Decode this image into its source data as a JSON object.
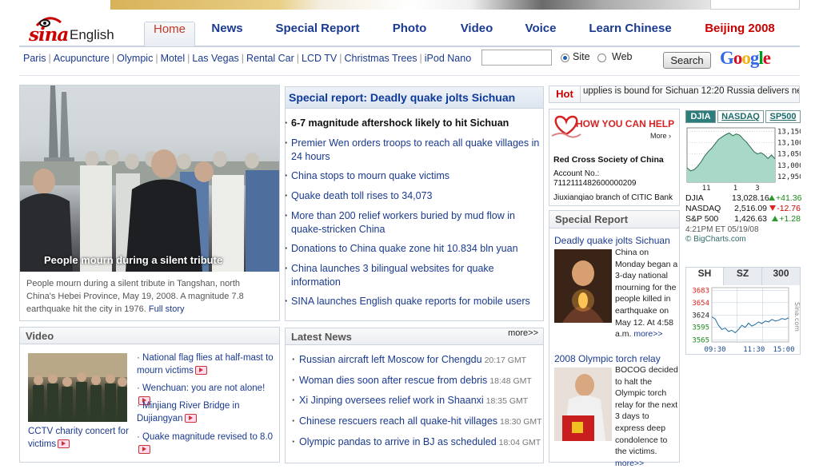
{
  "header": {
    "logo_text": "sina",
    "logo_suffix": "English",
    "nav": [
      "Home",
      "News",
      "Special Report",
      "Photo",
      "Video",
      "Voice",
      "Learn Chinese",
      "Beijing 2008"
    ],
    "quicklinks": [
      "Paris",
      "Acupuncture",
      "Olympic",
      "Motel",
      "Las Vegas",
      "Rental Car",
      "LCD TV",
      "Christmas Trees",
      "iPod Nano"
    ],
    "search": {
      "site_label": "Site",
      "web_label": "Web",
      "button": "Search",
      "value": ""
    },
    "google": [
      "G",
      "o",
      "o",
      "g",
      "l",
      "e"
    ]
  },
  "feature": {
    "caption": "People mourn during a silent tribute",
    "desc": "People mourn during a silent tribute in Tangshan, north China's Hebei Province, May 19, 2008. A magnitude 7.8 earthquake hit the city in 1976.",
    "link": "Full story"
  },
  "video": {
    "title": "Video",
    "thumb_caption": "CCTV charity concert for victims",
    "items": [
      "National flag flies at half-mast to mourn victims",
      "Wenchuan: you are not alone!",
      "Minjiang River Bridge in Dujiangyan",
      "Quake magnitude revised to 8.0"
    ]
  },
  "special_report": {
    "title": "Special report: Deadly quake jolts Sichuan",
    "items": [
      "6-7 magnitude aftershock likely to hit Sichuan",
      "Premier Wen orders troops to reach all quake villages in 24 hours",
      "China stops to mourn quake victims",
      "Quake death toll rises to 34,073",
      "More than 200 relief workers buried by mud flow in quake-stricken China",
      "Donations to China quake zone hit 10.834 bln yuan",
      "China launches 3 bilingual websites for quake information",
      "SINA launches English quake reports for mobile users"
    ]
  },
  "latest_news": {
    "title": "Latest News",
    "more": "more>>",
    "items": [
      {
        "title": "Russian aircraft left Moscow for Chengdu",
        "time": "20:17 GMT"
      },
      {
        "title": "Woman dies soon after rescue from debris",
        "time": "18:48 GMT"
      },
      {
        "title": "Xi Jinping oversees relief work in Shaanxi",
        "time": "18:35 GMT"
      },
      {
        "title": "Chinese rescuers reach all quake-hit villages",
        "time": "18:30 GMT"
      },
      {
        "title": "Olympic pandas to arrive in BJ as scheduled",
        "time": "18:04 GMT"
      }
    ]
  },
  "hot": {
    "label": "Hot",
    "ticker": "upplies is bound for Sichuan   12:20 Russia delivers new"
  },
  "help": {
    "title": "HOW YOU CAN HELP",
    "more": "More ›",
    "org": "Red Cross Society of China",
    "account": "Account No.: 7112111482600000209",
    "branch": "Jiuxianqiao branch of CITIC Bank"
  },
  "sidebar_special": {
    "title": "Special Report",
    "stories": [
      {
        "title": "Deadly quake jolts Sichuan",
        "text": "China on Monday began a 3-day national mourning for the people killed in earthquake on May 12. At 4:58 a.m.",
        "more": "more>>"
      },
      {
        "title": "2008 Olympic torch relay",
        "text": "BOCOG decided to halt the Olympic torch relay for the next 3 days to express deep condolence to the victims.",
        "more": "more>>"
      }
    ]
  },
  "markets": {
    "tabs": [
      "DJIA",
      "NASDAQ",
      "SP500"
    ],
    "rows": [
      {
        "name": "DJIA",
        "value": "13,028.16",
        "change": "+41.36",
        "dir": "up"
      },
      {
        "name": "NASDAQ",
        "value": "2,516.09",
        "change": "-12.76",
        "dir": "down"
      },
      {
        "name": "S&P 500",
        "value": "1,426.63",
        "change": "+1.28",
        "dir": "up"
      }
    ],
    "stamp": "4:21PM ET 05/19/08",
    "source": "© BigCharts.com",
    "sh_tabs": [
      "SH",
      "SZ",
      "300"
    ],
    "sh_watermark": "Sina.com"
  },
  "chart_data": [
    {
      "type": "area",
      "x_ticks": [
        "11",
        "1",
        "3"
      ],
      "y_ticks": [
        13150,
        13100,
        13050,
        13000,
        12950
      ],
      "ylim": [
        12925,
        13165
      ],
      "series": [
        {
          "values": [
            12988,
            12975,
            12980,
            12995,
            13015,
            13040,
            13060,
            13075,
            13095,
            13115,
            13125,
            13135,
            13142,
            13130,
            13138,
            13132,
            13115,
            13100,
            13080,
            13060,
            13050,
            13055,
            13045,
            13030,
            13045,
            13028
          ]
        }
      ],
      "colors": {
        "fill": "#a8d8c8",
        "line": "#2a6a4a",
        "grid": "#999"
      }
    },
    {
      "type": "line",
      "x_ticks": [
        "09:30",
        "11:30",
        "15:00"
      ],
      "y_ticks": [
        3683,
        3654,
        3624,
        3595,
        3565
      ],
      "ylim": [
        3560,
        3690
      ],
      "series": [
        {
          "values": [
            3620,
            3615,
            3600,
            3590,
            3593,
            3585,
            3588,
            3582,
            3590,
            3600,
            3595,
            3605,
            3598,
            3602,
            3608,
            3604,
            3610,
            3608,
            3614,
            3610,
            3612,
            3616,
            3614,
            3618
          ]
        }
      ],
      "colors": {
        "line": "#1a6aa0",
        "grid": "#bcd"
      }
    }
  ]
}
